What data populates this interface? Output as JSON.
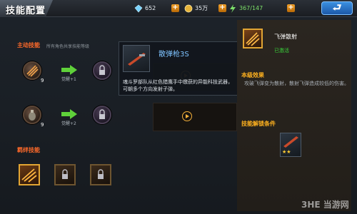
{
  "header": {
    "title": "技能配置",
    "resources": [
      {
        "icon": "diamond-icon",
        "value": "652"
      },
      {
        "icon": "coin-icon",
        "value": "35万"
      },
      {
        "icon": "stamina-icon",
        "value": "367/147"
      }
    ],
    "add_label": "+",
    "back_label": "⮐"
  },
  "active_skills": {
    "title": "主动技能",
    "subtitle": "所有角色共享技能等级",
    "rows": [
      {
        "level": "9",
        "upgrade_label": "觉醒+1"
      },
      {
        "level": "9",
        "upgrade_label": "觉醒+2"
      }
    ]
  },
  "bond_skills": {
    "title": "羁绊技能"
  },
  "popup": {
    "name": "散弹枪3S",
    "description": "魂斗罗部队从红色猎鹰手中缴获的异能科技武器，可朝多个方向发射子弹。"
  },
  "detail": {
    "name": "飞弹散射",
    "status": "已激活",
    "effect_title": "本级效果",
    "effect_text": "攻破飞弹变为散射，散射飞弹造成较低的伤害。",
    "unlock_title": "技能解锁条件",
    "unlock_stars": "★★"
  },
  "watermark": "3HE 当游网",
  "colors": {
    "accent_orange": "#ff6a2a",
    "accent_gold": "#ffb21f",
    "active_green": "#39d43a",
    "popup_title_blue": "#7ec3ff"
  }
}
